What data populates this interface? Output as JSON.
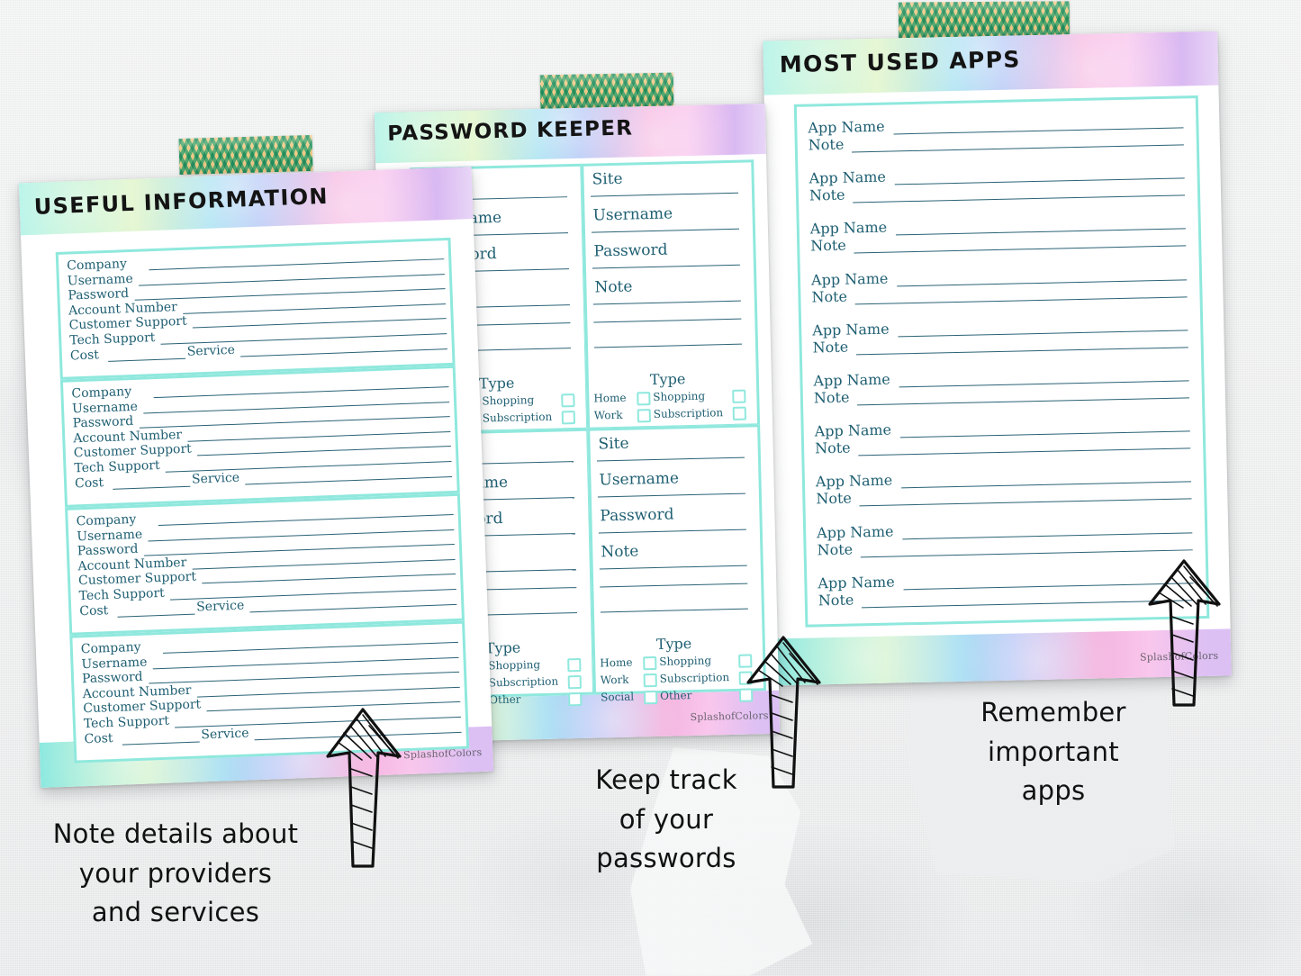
{
  "background": {
    "wall_color": "#eceded",
    "paper_white": "#ffffff"
  },
  "palette": {
    "mint_border": "#8fe8dd",
    "ink": "#1f5f72",
    "line": "#2a6275",
    "washi_green": "#4ebb95",
    "washi_cream": "#f7e2b6",
    "caption_black": "#111111"
  },
  "sheets": [
    {
      "id": "useful-information",
      "title": "USEFUL INFORMATION",
      "watermark": "SplashofColors",
      "washi_tape": "chevron-washi-tape",
      "block_count": 4,
      "fields": [
        "Company",
        "Username",
        "Password",
        "Account Number",
        "Customer Support",
        "Tech Support"
      ],
      "last_row": {
        "left": "Cost",
        "right": "Service"
      }
    },
    {
      "id": "password-keeper",
      "title": "PASSWORD KEEPER",
      "watermark": "SplashofColors",
      "washi_tape": "chevron-washi-tape",
      "card_count": 4,
      "fields": [
        "Site",
        "Username",
        "Password",
        "Note"
      ],
      "type_heading": "Type",
      "type_options_left": [
        "Home",
        "Work",
        "Social"
      ],
      "type_options_right": [
        "Shopping",
        "Subscription",
        "Other"
      ]
    },
    {
      "id": "most-used-apps",
      "title": "MOST USED APPS",
      "watermark": "SplashofColors",
      "washi_tape": "chevron-washi-tape",
      "row_count": 10,
      "fields": [
        "App Name",
        "Note"
      ]
    }
  ],
  "captions": [
    {
      "id": "caption-providers",
      "lines": [
        "Note details about",
        "your providers",
        "and services"
      ]
    },
    {
      "id": "caption-passwords",
      "lines": [
        "Keep track",
        "of your",
        "passwords"
      ]
    },
    {
      "id": "caption-apps",
      "lines": [
        "Remember",
        "important",
        "apps"
      ]
    }
  ]
}
